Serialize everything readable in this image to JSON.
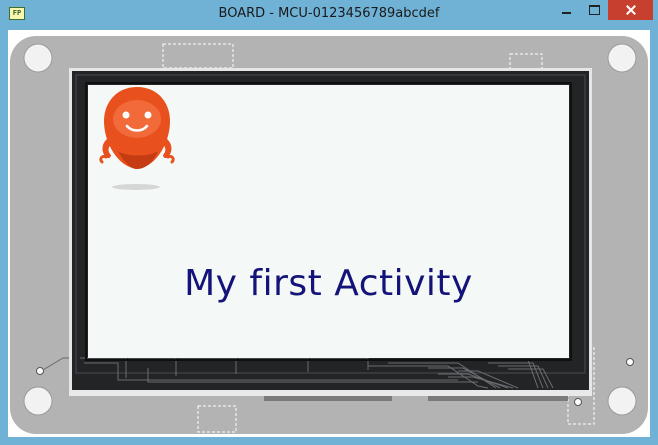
{
  "window": {
    "title": "BOARD - MCU-0123456789abcdef",
    "app_icon_text": "FP"
  },
  "screen": {
    "activity_text": "My first Activity"
  },
  "colors": {
    "titlebar": "#6fb2d6",
    "close_button": "#c7402f",
    "board_gray": "#b3b3b3",
    "bezel": "#222426",
    "screen_bg": "#f4f8f6",
    "robot_orange": "#e8501e",
    "text_navy": "#13137a"
  },
  "icons": {
    "app": "app-icon",
    "robot": "robot-mascot-icon"
  }
}
